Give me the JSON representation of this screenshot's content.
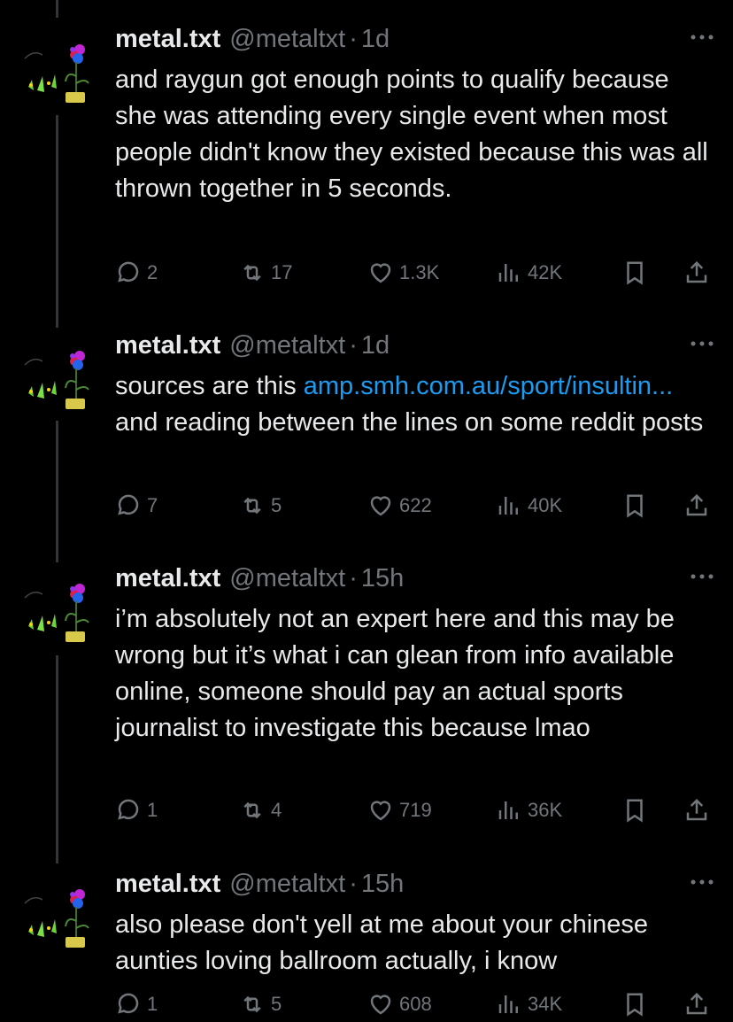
{
  "tweets": [
    {
      "name": "metal.txt",
      "handle": "@metaltxt",
      "dot": "·",
      "time": "1d",
      "text": "and raygun got enough points to qualify because she was attending every single event when most people didn't know they existed because this was all thrown together in 5 seconds.",
      "link": "",
      "text_after": "",
      "replies": "2",
      "reposts": "17",
      "likes": "1.3K",
      "views": "42K"
    },
    {
      "name": "metal.txt",
      "handle": "@metaltxt",
      "dot": "·",
      "time": "1d",
      "text": "sources are this ",
      "link": "amp.smh.com.au/sport/insultin...",
      "text_after": " and reading between the lines on some reddit posts",
      "replies": "7",
      "reposts": "5",
      "likes": "622",
      "views": "40K"
    },
    {
      "name": "metal.txt",
      "handle": "@metaltxt",
      "dot": "·",
      "time": "15h",
      "text": "i’m absolutely not an expert here and this may be wrong but it’s what i can glean from info available online, someone should pay an actual sports journalist to investigate this because lmao",
      "link": "",
      "text_after": "",
      "replies": "1",
      "reposts": "4",
      "likes": "719",
      "views": "36K"
    },
    {
      "name": "metal.txt",
      "handle": "@metaltxt",
      "dot": "·",
      "time": "15h",
      "text": "also please don't yell at me about your chinese aunties loving ballroom actually, i know",
      "link": "",
      "text_after": "",
      "replies": "1",
      "reposts": "5",
      "likes": "608",
      "views": "34K"
    }
  ],
  "colors": {
    "background": "#000000",
    "text": "#e7e9ea",
    "muted": "#71767b",
    "link": "#1d9bf0"
  }
}
